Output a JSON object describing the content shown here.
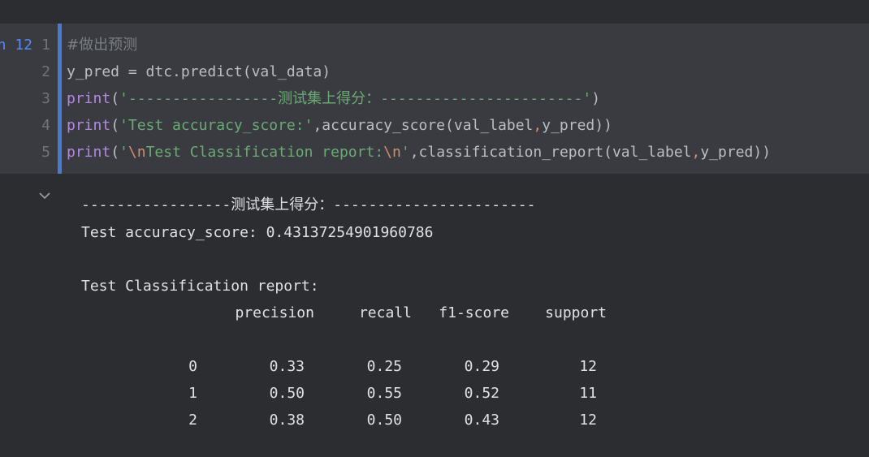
{
  "cell": {
    "execution_label": "n 12",
    "line_numbers": [
      "1",
      "2",
      "3",
      "4",
      "5"
    ],
    "code": {
      "l1_comment": "#做出预测",
      "l2_text": "y_pred = dtc.predict(val_data)",
      "l3_print": "print",
      "l3_open": "(",
      "l3_string_a": "'-----------------",
      "l3_string_cn": "测试集上得分：",
      "l3_string_b": "-----------------------'",
      "l3_close": ")",
      "l4_print": "print",
      "l4_open": "(",
      "l4_string": "'Test accuracy_score:'",
      "l4_comma": ",",
      "l4_call": "accuracy_score(val_label",
      "l4_comma2": ",",
      "l4_tail": "y_pred))",
      "l5_print": "print",
      "l5_open": "(",
      "l5_q1": "'",
      "l5_esc1": "\\n",
      "l5_str": "Test Classification report:",
      "l5_esc2": "\\n",
      "l5_q2": "'",
      "l5_comma": ",",
      "l5_call": "classification_report(val_label",
      "l5_comma2": ",",
      "l5_tail": "y_pred))"
    }
  },
  "output": {
    "header_a": "-----------------",
    "header_cn": "测试集上得分：",
    "header_b": "-----------------------",
    "accuracy_line": "Test accuracy_score: 0.43137254901960786",
    "report_title": "Test Classification report:",
    "report_columns": [
      "precision",
      "recall",
      "f1-score",
      "support"
    ],
    "report_rows": [
      {
        "label": "0",
        "precision": "0.33",
        "recall": "0.25",
        "f1": "0.29",
        "support": "12"
      },
      {
        "label": "1",
        "precision": "0.50",
        "recall": "0.55",
        "f1": "0.52",
        "support": "11"
      },
      {
        "label": "2",
        "precision": "0.38",
        "recall": "0.50",
        "f1": "0.43",
        "support": "12"
      }
    ]
  },
  "icons": {
    "collapse": "chevron-down-icon"
  },
  "colors": {
    "background": "#2b2d30",
    "cell_background": "#393b40",
    "cell_marker": "#4a7bd0",
    "keyword": "#b18ae0",
    "string": "#6aab73",
    "escape": "#cf8e6d",
    "comment": "#7a7e85",
    "execution_count": "#548af7",
    "text": "#bcbec4"
  }
}
